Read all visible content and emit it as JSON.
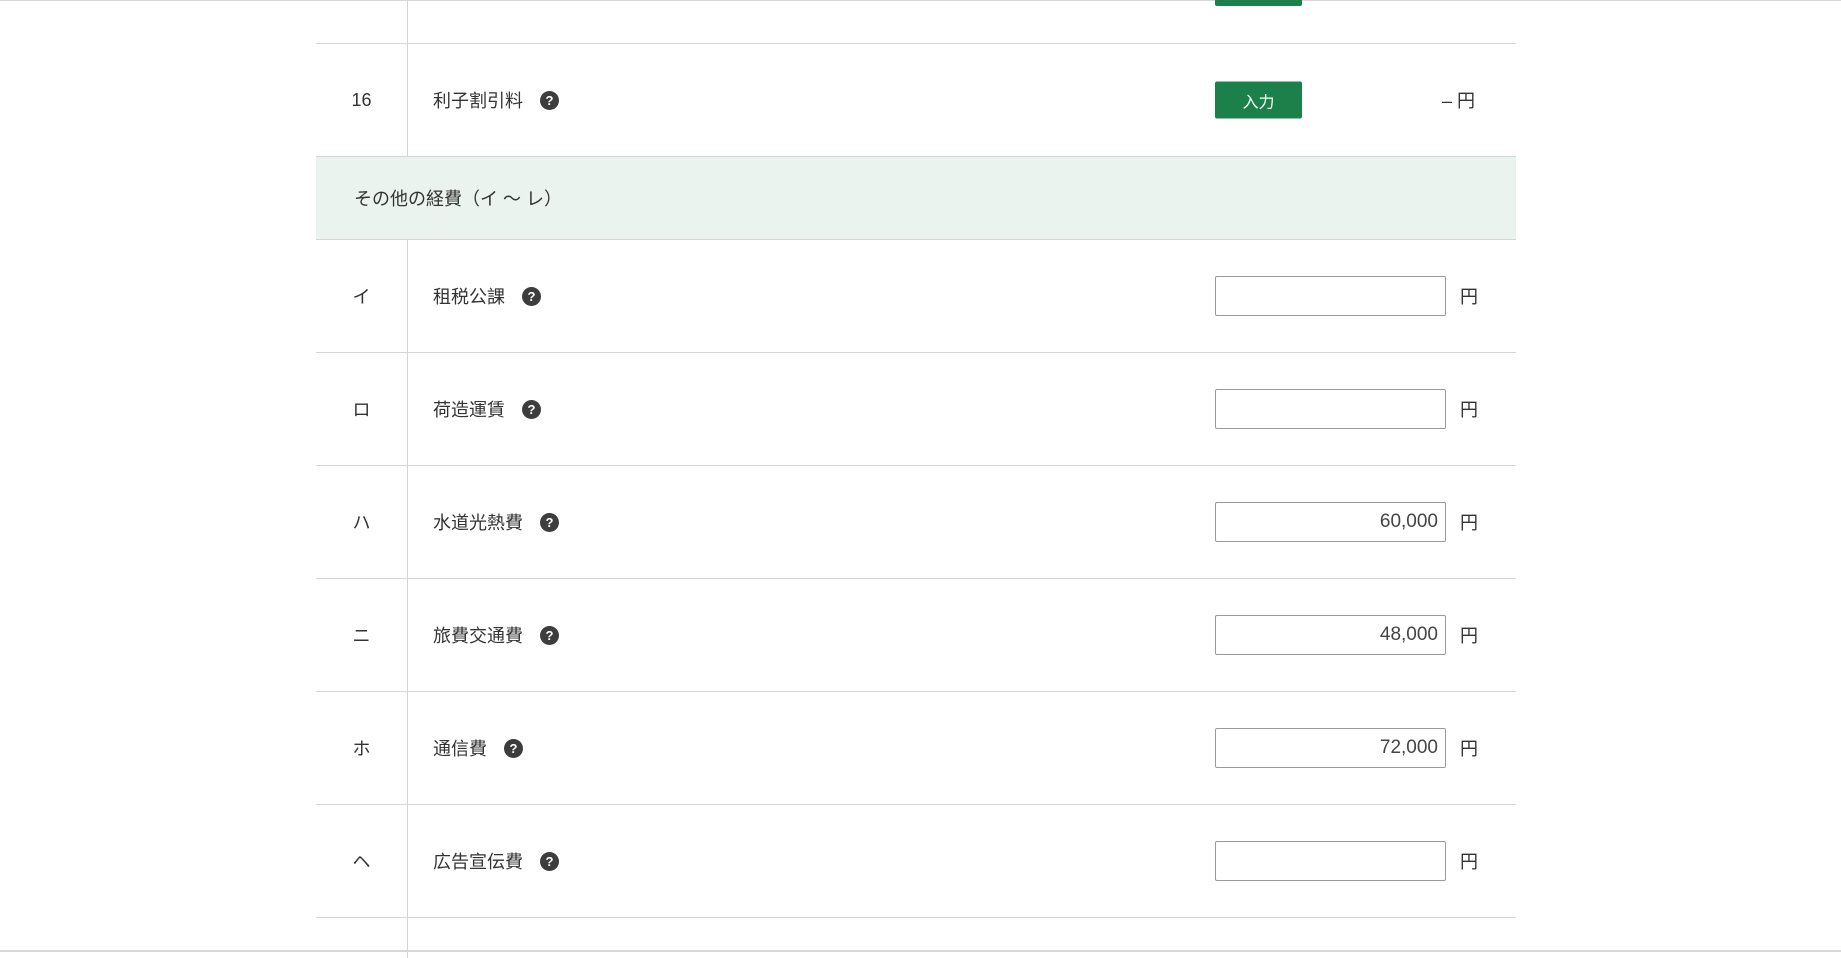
{
  "rows_top": {
    "partial_row": {
      "button_label": ""
    },
    "row_16": {
      "number": "16",
      "label": "利子割引料",
      "button_label": "入力",
      "value": "– 円"
    }
  },
  "section": {
    "title": "その他の経費（イ ～ レ）"
  },
  "expense_rows": [
    {
      "number": "イ",
      "label": "租税公課",
      "value": "",
      "unit": "円"
    },
    {
      "number": "ロ",
      "label": "荷造運賃",
      "value": "",
      "unit": "円"
    },
    {
      "number": "ハ",
      "label": "水道光熱費",
      "value": "60,000",
      "unit": "円"
    },
    {
      "number": "ニ",
      "label": "旅費交通費",
      "value": "48,000",
      "unit": "円"
    },
    {
      "number": "ホ",
      "label": "通信費",
      "value": "72,000",
      "unit": "円"
    },
    {
      "number": "ヘ",
      "label": "広告宣伝費",
      "value": "",
      "unit": "円"
    }
  ],
  "help_icon_glyph": "?",
  "colors": {
    "accent_green": "#1b8049",
    "section_bg": "#ebf3ee"
  }
}
